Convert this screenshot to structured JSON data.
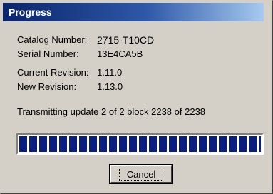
{
  "window": {
    "title": "Progress"
  },
  "info": [
    {
      "label": "Catalog Number:",
      "value": "2715-T10CD"
    },
    {
      "label": "Serial Number:",
      "value": "13E4CA5B"
    },
    {
      "label": "Current Revision:",
      "value": "1.11.0"
    },
    {
      "label": "New Revision:",
      "value": "1.13.0"
    }
  ],
  "status": {
    "text": "Transmitting update 2 of 2  block 2238 of 2238"
  },
  "progress": {
    "fraction": 1.0,
    "color": "#0a1e82"
  },
  "buttons": {
    "cancel_label": "Cancel"
  },
  "colors": {
    "titlebar": "#0a246a",
    "face": "#d4d0c8"
  }
}
